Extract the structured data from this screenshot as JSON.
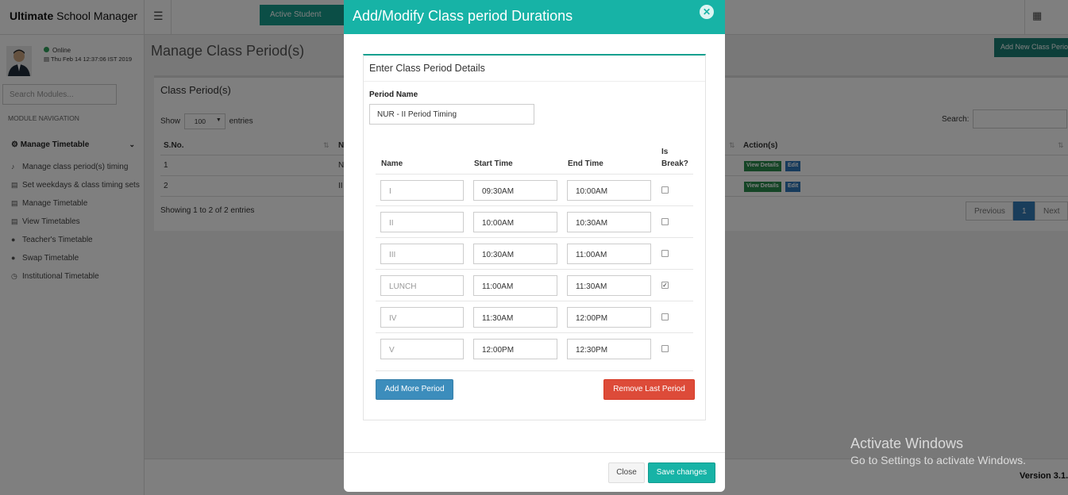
{
  "app": {
    "brand_bold": "Ultimate",
    "brand_rest": " School Manager",
    "menu_icon": "hamburger-icon",
    "active_student_label": "Active Student",
    "apps_icon": "grid-icon",
    "version": "Version 3.1."
  },
  "sidebar": {
    "status": "Online",
    "datetime": "Thu Feb 14 12:37:06 IST 2019",
    "search_placeholder": "Search Modules...",
    "nav_heading": "MODULE NAVIGATION",
    "group_label": "Manage Timetable",
    "items": [
      {
        "label": "Manage class period(s) timing",
        "icon": "bell-icon"
      },
      {
        "label": "Set weekdays & class timing sets",
        "icon": "calendar-icon"
      },
      {
        "label": "Manage Timetable",
        "icon": "calendar-icon"
      },
      {
        "label": "View Timetables",
        "icon": "calendar-icon"
      },
      {
        "label": "Teacher's Timetable",
        "icon": "user-icon"
      },
      {
        "label": "Swap Timetable",
        "icon": "user-icon"
      },
      {
        "label": "Institutional Timetable",
        "icon": "clock-icon"
      }
    ]
  },
  "page": {
    "title": "Manage Class Period(s)",
    "add_new_label": "Add New Class Period",
    "panel_title": "Class Period(s)",
    "show_label": "Show",
    "entries_value": "100",
    "entries_label": "entries",
    "search_label": "Search:",
    "columns": [
      "S.No.",
      "N",
      "Action(s)"
    ],
    "rows": [
      {
        "sno": "1",
        "name": "N",
        "view": "View Details",
        "edit": "Edit"
      },
      {
        "sno": "2",
        "name": "II",
        "view": "View Details",
        "edit": "Edit"
      }
    ],
    "showing": "Showing 1 to 2 of 2 entries",
    "pager": {
      "previous": "Previous",
      "current": "1",
      "next": "Next"
    }
  },
  "modal": {
    "title": "Add/Modify Class period Durations",
    "box_title": "Enter Class Period Details",
    "period_name_label": "Period Name",
    "period_name_value": "NUR - II Period Timing",
    "columns": {
      "name": "Name",
      "start": "Start Time",
      "end": "End Time",
      "is_break_1": "Is",
      "is_break_2": "Break?"
    },
    "periods": [
      {
        "name": "I",
        "start": "09:30AM",
        "end": "10:00AM",
        "is_break": false
      },
      {
        "name": "II",
        "start": "10:00AM",
        "end": "10:30AM",
        "is_break": false
      },
      {
        "name": "III",
        "start": "10:30AM",
        "end": "11:00AM",
        "is_break": false
      },
      {
        "name": "LUNCH",
        "start": "11:00AM",
        "end": "11:30AM",
        "is_break": true
      },
      {
        "name": "IV",
        "start": "11:30AM",
        "end": "12:00PM",
        "is_break": false
      },
      {
        "name": "V",
        "start": "12:00PM",
        "end": "12:30PM",
        "is_break": false
      }
    ],
    "add_more_label": "Add More Period",
    "remove_last_label": "Remove Last Period",
    "close_label": "Close",
    "save_label": "Save changes",
    "close_icon": "close-icon"
  },
  "watermark": {
    "line1": "Activate Windows",
    "line2": "Go to Settings to activate Windows."
  },
  "colors": {
    "teal": "#17b3a6",
    "primary_blue": "#3c8dbc",
    "danger_red": "#dd4b39",
    "overlay": "rgba(0,0,0,0.5)"
  }
}
